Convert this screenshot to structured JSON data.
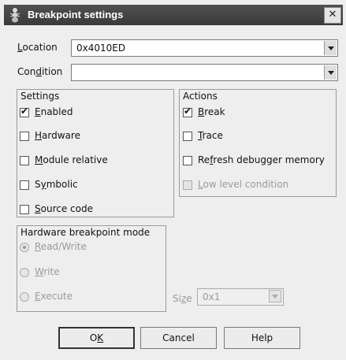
{
  "window": {
    "title": "Breakpoint settings",
    "close_glyph": "✕",
    "title_icon": "ant-icon"
  },
  "location": {
    "label_key": "L",
    "label_rest": "ocation",
    "value": "0x4010ED"
  },
  "condition": {
    "label_pre": "Con",
    "label_key": "d",
    "label_rest": "ition",
    "value": ""
  },
  "settings": {
    "title": "Settings",
    "items": [
      {
        "key": "E",
        "rest": "nabled",
        "pre": "",
        "checked": true
      },
      {
        "key": "H",
        "rest": "ardware",
        "pre": "",
        "checked": false
      },
      {
        "key": "M",
        "rest": "odule relative",
        "pre": "",
        "checked": false
      },
      {
        "key": "y",
        "rest": "mbolic",
        "pre": "S",
        "checked": false
      },
      {
        "key": "S",
        "rest": "ource code",
        "pre": "",
        "checked": false
      }
    ]
  },
  "actions": {
    "title": "Actions",
    "items": [
      {
        "key": "B",
        "rest": "reak",
        "pre": "",
        "checked": true
      },
      {
        "key": "T",
        "rest": "race",
        "pre": "",
        "checked": false
      },
      {
        "key": "f",
        "rest": "resh debugger memory",
        "pre": "Re",
        "checked": false
      },
      {
        "key": "L",
        "rest": "ow level condition",
        "pre": "",
        "checked": false,
        "disabled": true
      }
    ]
  },
  "hw_mode": {
    "title": "Hardware breakpoint mode",
    "options": [
      {
        "key": "R",
        "rest": "ead/Write",
        "selected": true
      },
      {
        "key": "W",
        "rest": "rite",
        "selected": false
      },
      {
        "key": "E",
        "rest": "xecute",
        "selected": false
      }
    ]
  },
  "size": {
    "label_pre": "Si",
    "label_key": "z",
    "label_rest": "e",
    "value": "0x1"
  },
  "buttons": {
    "ok_pre": "O",
    "ok_key": "K",
    "cancel": "Cancel",
    "help": "Help"
  }
}
